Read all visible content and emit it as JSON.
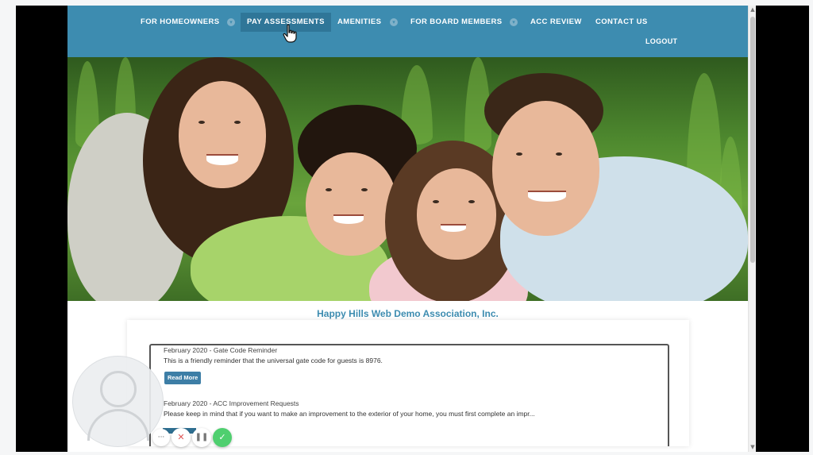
{
  "nav": {
    "items": [
      {
        "label": "FOR HOMEOWNERS",
        "has_caret": true
      },
      {
        "label": "PAY ASSESSMENTS",
        "has_caret": false,
        "active": true
      },
      {
        "label": "AMENITIES",
        "has_caret": true
      },
      {
        "label": "FOR BOARD MEMBERS",
        "has_caret": true
      },
      {
        "label": "ACC REVIEW",
        "has_caret": false
      },
      {
        "label": "CONTACT US",
        "has_caret": false
      }
    ],
    "logout_label": "LOGOUT",
    "caret_icon": "chevron-down-icon"
  },
  "hero": {
    "image": "family-photo"
  },
  "association": {
    "name": "Happy Hills Web Demo Association, Inc."
  },
  "news": [
    {
      "title": "February 2020 - Gate Code Reminder",
      "body": "This is a friendly reminder that the universal gate code for guests is 8976.",
      "button_label": "Read More"
    },
    {
      "title": "February 2020 - ACC Improvement Requests",
      "body": "Please keep in mind that if you want to make an improvement to the exterior of your home, you must first complete an impr..."
    }
  ],
  "recorder_controls": {
    "more_icon": "more-icon",
    "cancel_icon": "close-icon",
    "pause_icon": "pause-icon",
    "done_icon": "check-icon",
    "more_glyph": "···",
    "cancel_glyph": "✕",
    "pause_glyph": "❚❚",
    "done_glyph": "✓"
  },
  "colors": {
    "nav_bg": "#3d8cb0",
    "accent": "#3d8cb0",
    "done_green": "#4fcf6f",
    "cancel_red": "#e05656"
  }
}
